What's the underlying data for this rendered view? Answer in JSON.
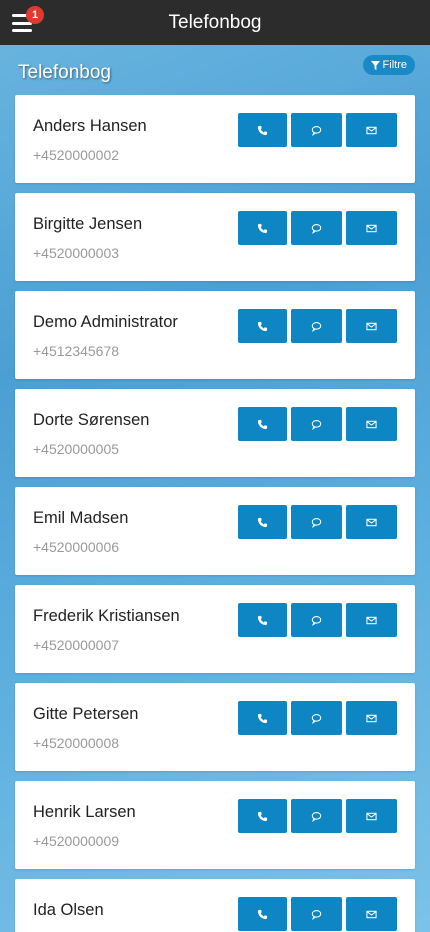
{
  "topbar": {
    "title": "Telefonbog",
    "notification_count": "1"
  },
  "page": {
    "title": "Telefonbog",
    "filter_label": "Filtre"
  },
  "contacts": [
    {
      "name": "Anders Hansen",
      "phone": "+4520000002"
    },
    {
      "name": "Birgitte Jensen",
      "phone": "+4520000003"
    },
    {
      "name": "Demo Administrator",
      "phone": "+4512345678"
    },
    {
      "name": "Dorte Sørensen",
      "phone": "+4520000005"
    },
    {
      "name": "Emil Madsen",
      "phone": "+4520000006"
    },
    {
      "name": "Frederik Kristiansen",
      "phone": "+4520000007"
    },
    {
      "name": "Gitte Petersen",
      "phone": "+4520000008"
    },
    {
      "name": "Henrik Larsen",
      "phone": "+4520000009"
    },
    {
      "name": "Ida Olsen",
      "phone": ""
    }
  ],
  "icons": {
    "call": "phone-icon",
    "sms": "chat-bubble-icon",
    "mail": "envelope-icon",
    "menu": "hamburger-icon",
    "filter": "funnel-icon"
  },
  "colors": {
    "topbar": "#2c2c2c",
    "accent": "#0d86c3",
    "badge": "#e03a2f",
    "phone_text": "#9a9a9a"
  }
}
